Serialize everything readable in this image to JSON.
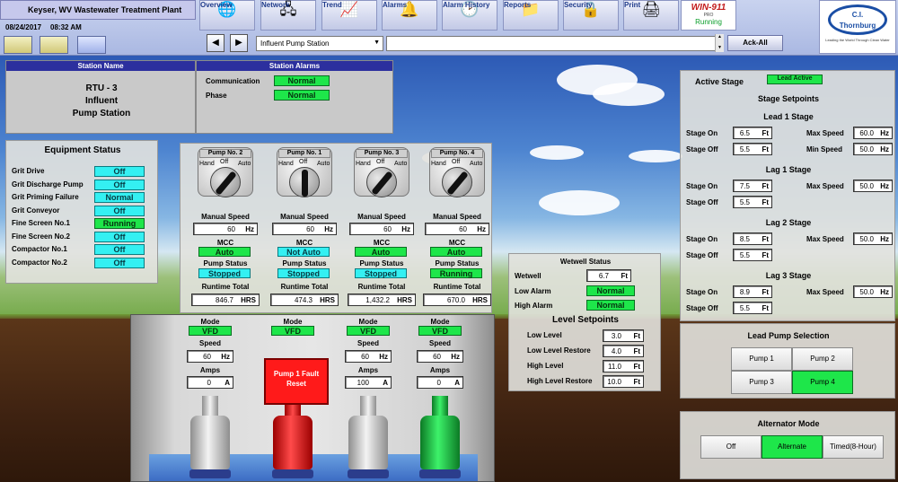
{
  "header": {
    "plant_title": "Keyser, WV Wastewater Treatment Plant",
    "date": "08/24/2017",
    "time": "08:32 AM",
    "nav": [
      {
        "label": "Overview",
        "icon": "globe-icon",
        "glyph": "🌐"
      },
      {
        "label": "Network",
        "icon": "network-icon",
        "glyph": "🖧"
      },
      {
        "label": "Trend",
        "icon": "trend-icon",
        "glyph": "📈"
      },
      {
        "label": "Alarms",
        "icon": "bell-icon",
        "glyph": "🔔"
      },
      {
        "label": "Alarm History",
        "icon": "clock-icon",
        "glyph": "🕑"
      },
      {
        "label": "Reports",
        "icon": "folder-icon",
        "glyph": "📁"
      },
      {
        "label": "Security",
        "icon": "lock-icon",
        "glyph": "🔒"
      },
      {
        "label": "Print",
        "icon": "printer-icon",
        "glyph": "🖨"
      }
    ],
    "win911": {
      "title": "WIN-911",
      "sub": "PRO",
      "status": "Running"
    },
    "logo": {
      "line1": "C.I.",
      "line2": "Thornburg",
      "tagline": "Leading the World Through Clean Water"
    },
    "station_select": "Influent Pump Station",
    "ack_all": "Ack-All"
  },
  "station": {
    "name_header": "Station Name",
    "name_lines": [
      "RTU - 3",
      "Influent",
      "Pump Station"
    ],
    "alarms_header": "Station Alarms",
    "alarms": [
      {
        "label": "Communication",
        "value": "Normal"
      },
      {
        "label": "Phase",
        "value": "Normal"
      }
    ]
  },
  "equipment": {
    "title": "Equipment Status",
    "items": [
      {
        "label": "Grit Drive",
        "value": "Off",
        "state": "cyan"
      },
      {
        "label": "Grit Discharge Pump",
        "value": "Off",
        "state": "cyan"
      },
      {
        "label": "Grit Priming Failure",
        "value": "Normal",
        "state": "cyan"
      },
      {
        "label": "Grit Conveyor",
        "value": "Off",
        "state": "cyan"
      },
      {
        "label": "Fine Screen No.1",
        "value": "Running",
        "state": "green"
      },
      {
        "label": "Fine Screen No.2",
        "value": "Off",
        "state": "cyan"
      },
      {
        "label": "Compactor No.1",
        "value": "Off",
        "state": "cyan"
      },
      {
        "label": "Compactor No.2",
        "value": "Off",
        "state": "cyan"
      }
    ]
  },
  "pump_labels": {
    "hand": "Hand",
    "off": "Off",
    "auto": "Auto",
    "manual_speed": "Manual Speed",
    "mcc": "MCC",
    "pump_status": "Pump Status",
    "runtime_total": "Runtime Total",
    "hz": "Hz",
    "hrs": "HRS",
    "mode": "Mode",
    "speed": "Speed",
    "amps": "Amps",
    "a": "A"
  },
  "pumps": [
    {
      "name": "Pump No. 2",
      "manual_speed": "60",
      "mcc": "Auto",
      "mcc_state": "green",
      "status": "Stopped",
      "status_state": "cyan",
      "runtime": "846.7",
      "mode": "VFD",
      "speed": "60",
      "amps": "0",
      "color": "silver"
    },
    {
      "name": "Pump No. 1",
      "manual_speed": "60",
      "mcc": "Not Auto",
      "mcc_state": "cyan",
      "status": "Stopped",
      "status_state": "cyan",
      "runtime": "474.3",
      "mode": "VFD",
      "speed": "",
      "amps": "",
      "color": "red"
    },
    {
      "name": "Pump No. 3",
      "manual_speed": "60",
      "mcc": "Auto",
      "mcc_state": "green",
      "status": "Stopped",
      "status_state": "cyan",
      "runtime": "1,432.2",
      "mode": "VFD",
      "speed": "60",
      "amps": "100",
      "color": "silver"
    },
    {
      "name": "Pump No. 4",
      "manual_speed": "60",
      "mcc": "Auto",
      "mcc_state": "green",
      "status": "Running",
      "status_state": "green",
      "runtime": "670.0",
      "mode": "VFD",
      "speed": "60",
      "amps": "0",
      "color": "green"
    }
  ],
  "fault_button": "Pump 1 Fault Reset",
  "wetwell": {
    "title": "Wetwell Status",
    "rows": [
      {
        "label": "Wetwell",
        "value": "6.7",
        "unit": "Ft"
      },
      {
        "label": "Low Alarm",
        "status": "Normal"
      },
      {
        "label": "High Alarm",
        "status": "Normal"
      }
    ],
    "setpoints_title": "Level Setpoints",
    "setpoints": [
      {
        "label": "Low Level",
        "value": "3.0",
        "unit": "Ft"
      },
      {
        "label": "Low Level Restore",
        "value": "4.0",
        "unit": "Ft"
      },
      {
        "label": "High Level",
        "value": "11.0",
        "unit": "Ft"
      },
      {
        "label": "High Level Restore",
        "value": "10.0",
        "unit": "Ft"
      }
    ]
  },
  "stages": {
    "active_label": "Active Stage",
    "active_value": "Lead Active",
    "setpoints_title": "Stage Setpoints",
    "labels": {
      "stage_on": "Stage On",
      "stage_off": "Stage Off",
      "max_speed": "Max Speed",
      "min_speed": "Min Speed",
      "ft": "Ft",
      "hz": "Hz"
    },
    "list": [
      {
        "title": "Lead 1 Stage",
        "on": "6.5",
        "off": "5.5",
        "max_speed": "60.0",
        "min_speed": "50.0"
      },
      {
        "title": "Lag 1 Stage",
        "on": "7.5",
        "off": "5.5",
        "max_speed": "50.0"
      },
      {
        "title": "Lag 2 Stage",
        "on": "8.5",
        "off": "5.5",
        "max_speed": "50.0"
      },
      {
        "title": "Lag 3 Stage",
        "on": "8.9",
        "off": "5.5",
        "max_speed": "50.0"
      }
    ]
  },
  "lead_pump": {
    "title": "Lead Pump Selection",
    "buttons": [
      {
        "label": "Pump 1",
        "selected": false
      },
      {
        "label": "Pump 2",
        "selected": false
      },
      {
        "label": "Pump 3",
        "selected": false
      },
      {
        "label": "Pump 4",
        "selected": true
      }
    ]
  },
  "alternator": {
    "title": "Alternator Mode",
    "buttons": [
      {
        "label": "Off",
        "selected": false
      },
      {
        "label": "Alternate",
        "selected": true
      },
      {
        "label": "Timed(8-Hour)",
        "selected": false
      }
    ]
  }
}
